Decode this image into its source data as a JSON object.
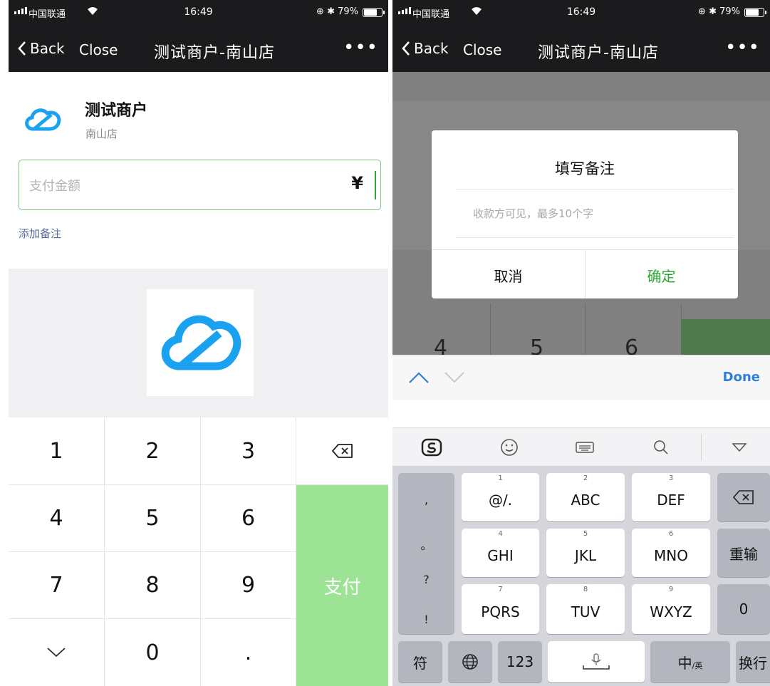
{
  "status_bar": {
    "carrier": "中国联通",
    "wifi_icon": "wifi-icon",
    "time": "16:49",
    "right_indicators": "⊕ ✱ 79%",
    "battery_level": 0.79
  },
  "nav": {
    "back_label": "Back",
    "close_label": "Close",
    "title": "测试商户-南山店",
    "more_label": "•••"
  },
  "left": {
    "merchant_name": "测试商户",
    "merchant_branch": "南山店",
    "amount_placeholder": "支付金额",
    "currency_symbol": "¥",
    "add_note": "添加备注",
    "keypad": {
      "keys": [
        "1",
        "2",
        "3",
        "4",
        "5",
        "6",
        "7",
        "8",
        "9",
        "0",
        "."
      ],
      "pay_label": "支付",
      "backspace_icon": "backspace-icon",
      "hide_icon": "chevron-down-icon"
    },
    "brand_color": "#1aa2f0",
    "pay_color": "#9de395"
  },
  "right": {
    "dialog": {
      "title": "填写备注",
      "placeholder": "收款方可见，最多10个字",
      "cancel_label": "取消",
      "confirm_label": "确定"
    },
    "background_digits": [
      "4",
      "5",
      "6"
    ],
    "accessory": {
      "up_icon": "chevron-up-icon",
      "down_icon": "chevron-down-icon",
      "done_label": "Done"
    },
    "candidate_bar": {
      "icons": [
        "sogou-logo-icon",
        "emoji-icon",
        "keyboard-icon",
        "search-icon",
        "collapse-triangle-icon"
      ]
    },
    "keyboard": {
      "punctuation": [
        ",",
        "。",
        "?",
        "!"
      ],
      "rows": [
        [
          {
            "num": "1",
            "label": "@/."
          },
          {
            "num": "2",
            "label": "ABC"
          },
          {
            "num": "3",
            "label": "DEF"
          }
        ],
        [
          {
            "num": "4",
            "label": "GHI"
          },
          {
            "num": "5",
            "label": "JKL"
          },
          {
            "num": "6",
            "label": "MNO"
          }
        ],
        [
          {
            "num": "7",
            "label": "PQRS"
          },
          {
            "num": "8",
            "label": "TUV"
          },
          {
            "num": "9",
            "label": "WXYZ"
          }
        ]
      ],
      "backspace_icon": "backspace-icon",
      "retype_label": "重输",
      "zero_label": "0",
      "symbol_label": "符",
      "globe_icon": "globe-icon",
      "numeric_label": "123",
      "mic_icon": "microphone-icon",
      "lang_label": "中",
      "lang_sub": "/英",
      "return_label": "换行"
    },
    "confirm_color": "#2ca635",
    "done_color": "#2f7ed8"
  }
}
